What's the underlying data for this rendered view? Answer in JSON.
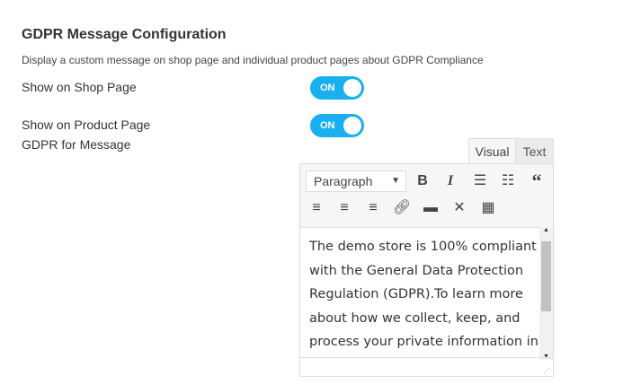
{
  "section": {
    "title": "GDPR Message Configuration",
    "description": "Display a custom message on shop page and individual product pages about GDPR Compliance"
  },
  "settings": [
    {
      "label": "Show on Shop Page",
      "value": "ON"
    },
    {
      "label": "Show on Product Page",
      "value": "ON"
    }
  ],
  "message_label": "GDPR for Message",
  "editor": {
    "tabs": [
      "Visual",
      "Text"
    ],
    "active_tab": "Visual",
    "format": "Paragraph",
    "toolbar_icons": [
      "bold-icon",
      "italic-icon",
      "bullet-list-icon",
      "numbered-list-icon",
      "blockquote-icon",
      "align-left-icon",
      "align-center-icon",
      "align-right-icon",
      "link-icon",
      "read-more-icon",
      "fullscreen-icon",
      "toolbar-toggle-icon"
    ],
    "content": "The demo store is 100% compliant with the General Data Protection Regulation (GDPR).To learn more about how we collect, keep, and process your private information in"
  },
  "colors": {
    "toggle": "#19aff0"
  }
}
